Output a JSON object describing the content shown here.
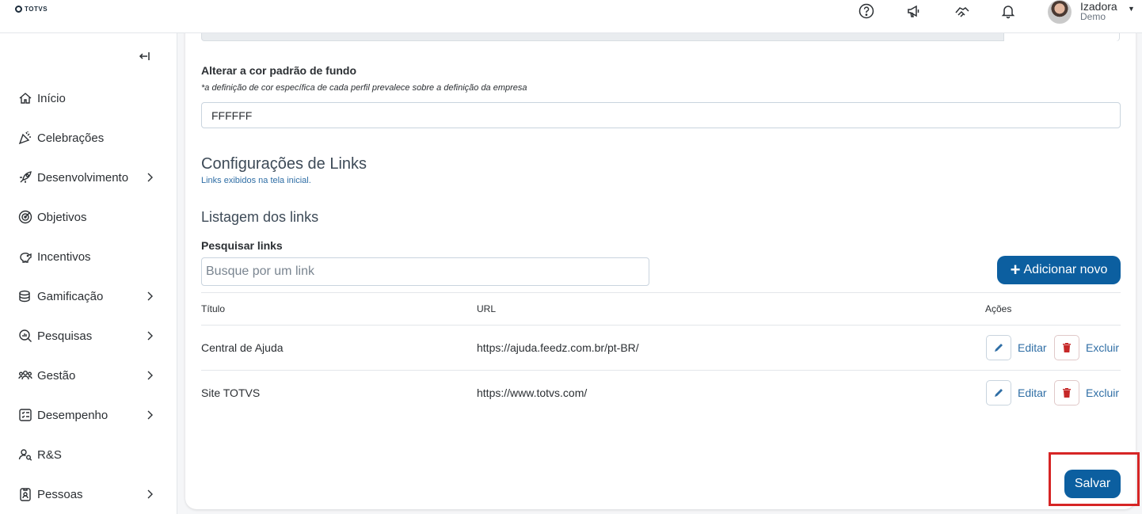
{
  "header": {
    "logo_text": "TOTVS",
    "icons": [
      "help-icon",
      "megaphone-icon",
      "handshake-icon",
      "bell-icon"
    ],
    "user": {
      "name": "Izadora",
      "role": "Demo"
    }
  },
  "sidebar": {
    "items": [
      {
        "label": "Início",
        "icon": "home-icon",
        "has_children": false
      },
      {
        "label": "Celebrações",
        "icon": "party-icon",
        "has_children": false
      },
      {
        "label": "Desenvolvimento",
        "icon": "rocket-icon",
        "has_children": true
      },
      {
        "label": "Objetivos",
        "icon": "target-icon",
        "has_children": false
      },
      {
        "label": "Incentivos",
        "icon": "piggy-bank-icon",
        "has_children": false
      },
      {
        "label": "Gamificação",
        "icon": "coins-icon",
        "has_children": true
      },
      {
        "label": "Pesquisas",
        "icon": "search-chart-icon",
        "has_children": true
      },
      {
        "label": "Gestão",
        "icon": "people-icon",
        "has_children": true
      },
      {
        "label": "Desempenho",
        "icon": "checklist-icon",
        "has_children": true
      },
      {
        "label": "R&S",
        "icon": "user-search-icon",
        "has_children": false
      },
      {
        "label": "Pessoas",
        "icon": "id-badge-icon",
        "has_children": true
      }
    ]
  },
  "main": {
    "bg_color": {
      "label": "Alterar a cor padrão de fundo",
      "hint": "*a definição de cor específica de cada perfil prevalece sobre a definição da empresa",
      "value": "FFFFFF"
    },
    "links_config": {
      "title": "Configurações de Links",
      "subtitle": "Links exibidos na tela inicial."
    },
    "listing": {
      "title": "Listagem dos links",
      "search_label": "Pesquisar links",
      "search_placeholder": "Busque por um link",
      "add_button": "Adicionar novo",
      "columns": [
        "Título",
        "URL",
        "Ações"
      ],
      "rows": [
        {
          "title": "Central de Ajuda",
          "url": "https://ajuda.feedz.com.br/pt-BR/",
          "edit": "Editar",
          "delete": "Excluir"
        },
        {
          "title": "Site TOTVS",
          "url": "https://www.totvs.com/",
          "edit": "Editar",
          "delete": "Excluir"
        }
      ]
    },
    "save_button": "Salvar"
  },
  "colors": {
    "primary": "#0c5fa0",
    "link": "#2f6ea5",
    "danger": "#c62828",
    "highlight": "#d62525"
  }
}
